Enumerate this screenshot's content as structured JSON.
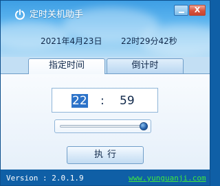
{
  "window": {
    "title": "定时关机助手",
    "icons": {
      "app": "power-icon",
      "minimize": "minimize-icon",
      "close": "close-icon"
    },
    "close_label": "X"
  },
  "clock": {
    "date": "2021年4月23日",
    "time": "22时29分42秒"
  },
  "tabs": [
    {
      "label": "指定时间",
      "active": true
    },
    {
      "label": "倒计时",
      "active": false
    }
  ],
  "schedule": {
    "hour": "22",
    "separator": ":",
    "minute": "59"
  },
  "slider": {
    "level": 1.0
  },
  "actions": {
    "execute_label": "执行"
  },
  "status": {
    "version": "Version : 2.0.1.9",
    "website": "www.yunguanji.com"
  },
  "colors": {
    "frame": "#0f5fa6",
    "selection": "#2d73c9",
    "link": "#3ee83e"
  }
}
